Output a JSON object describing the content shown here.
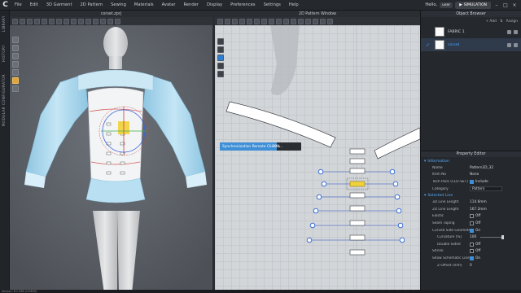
{
  "app": {
    "logo": "C",
    "menu": [
      "File",
      "Edit",
      "3D Garment",
      "2D Pattern",
      "Sewing",
      "Materials",
      "Avatar",
      "Render",
      "Display",
      "Preferences",
      "Settings",
      "Help"
    ],
    "user_greeting": "Hello,",
    "user_name": "user",
    "simulation_label": "SIMULATION",
    "status_text": "Version: 6.1.386 (r39826)"
  },
  "left_strip": {
    "tabs": [
      "LIBRARY",
      "HISTORY",
      "MODULAR CONFIGURATOR"
    ]
  },
  "panel3d": {
    "title": "corset.zprj"
  },
  "panel2d": {
    "title": "2D Pattern Window",
    "sync_label": "Synchronization Remote Clients...",
    "sync_percent": "70%",
    "sync_progress": 0.7
  },
  "object_browser": {
    "title": "Object Browser",
    "add_label": "+ Add",
    "sort_label": "Sort",
    "assign_label": "Assign",
    "fabrics": [
      {
        "name": "FABRIC 1",
        "selected": false
      },
      {
        "name": "corset",
        "selected": true
      }
    ]
  },
  "property_editor": {
    "title": "Property Editor",
    "information_header": "Information",
    "name_label": "Name",
    "name_value": "Pattern2D_32",
    "bom_label": "Item No",
    "bom_value": "None",
    "techpack_label": "Tech Pack (CLO-SET)",
    "techpack_value": "Include",
    "category_label": "Category",
    "category_value": "Pattern",
    "selected_line_header": "Selected Line",
    "line_length_3d_label": "3D Line Length",
    "line_length_3d_value": "114.6mm",
    "line_length_2d_label": "2D Line Length",
    "line_length_2d_value": "167.2mm",
    "elastic_label": "Elastic",
    "elastic_value": "Off",
    "seam_taping_label": "Seam Taping",
    "seam_taping_value": "Off",
    "curved_side_label": "Curved Side Geometry",
    "curved_side_value": "On",
    "curvature_label": "Curvature (%)",
    "curvature_value": "100",
    "double_sided_label": "Double Sided",
    "double_sided_value": "Off",
    "shrinkage_label": "Shrink",
    "shrinkage_value": "Off",
    "schematic_label": "Show Schematic Line",
    "schematic_value": "On",
    "zoffset_label": "Z-Offset (mm)",
    "zoffset_value": "0"
  },
  "colors": {
    "accent": "#3f8fd6",
    "highlight": "#4aa3ff",
    "selection_yellow": "#f2d23a",
    "pattern_line_blue": "#5a79c8",
    "garment_blue": "#a9d8ef"
  }
}
